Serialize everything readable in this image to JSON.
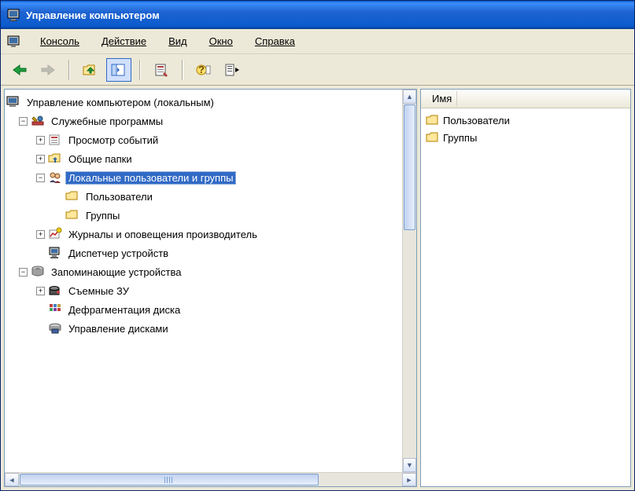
{
  "window": {
    "title": "Управление компьютером"
  },
  "menu": {
    "console": "Консоль",
    "action": "Действие",
    "view": "Вид",
    "window_m": "Окно",
    "help": "Справка"
  },
  "tree": {
    "root": "Управление компьютером (локальным)",
    "system_tools": "Служебные программы",
    "event_viewer": "Просмотр событий",
    "shared_folders": "Общие папки",
    "local_users_groups": "Локальные пользователи и группы",
    "users": "Пользователи",
    "groups": "Группы",
    "perf_logs": "Журналы и оповещения производитель",
    "device_mgr": "Диспетчер устройств",
    "storage": "Запоминающие устройства",
    "removable": "Съемные ЗУ",
    "defrag": "Дефрагментация диска",
    "disk_mgmt": "Управление дисками"
  },
  "list": {
    "header_name": "Имя",
    "items": [
      {
        "label": "Пользователи"
      },
      {
        "label": "Группы"
      }
    ]
  }
}
